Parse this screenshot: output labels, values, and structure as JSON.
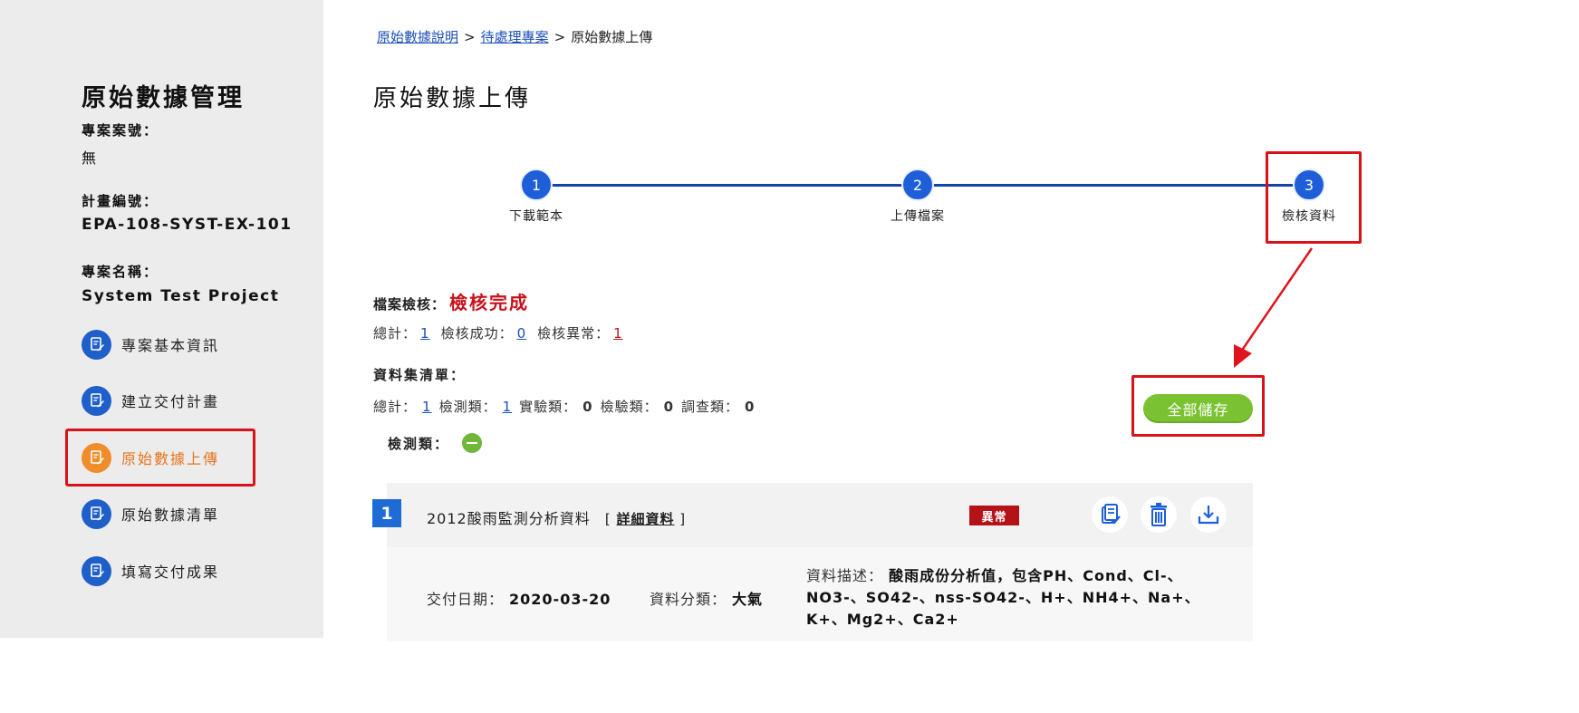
{
  "sidebar": {
    "title": "原始數據管理",
    "case_no_label": "專案案號：",
    "case_no_value": "無",
    "plan_no_label": "計畫編號：",
    "plan_no_value": "EPA-108-SYST-EX-101",
    "project_name_label": "專案名稱：",
    "project_name_value": "System Test Project",
    "menu": [
      {
        "label": "專案基本資訊",
        "icon": "edit-document-icon"
      },
      {
        "label": "建立交付計畫",
        "icon": "edit-document-icon"
      },
      {
        "label": "原始數據上傳",
        "icon": "edit-document-icon",
        "active": true
      },
      {
        "label": "原始數據清單",
        "icon": "edit-document-icon"
      },
      {
        "label": "填寫交付成果",
        "icon": "edit-document-icon"
      }
    ]
  },
  "breadcrumb": {
    "item1": "原始數據說明",
    "item2": "待處理專案",
    "current": "原始數據上傳",
    "separator": ">"
  },
  "page_title": "原始數據上傳",
  "steps": [
    {
      "num": "1",
      "label": "下載範本"
    },
    {
      "num": "2",
      "label": "上傳檔案"
    },
    {
      "num": "3",
      "label": "檢核資料"
    }
  ],
  "check": {
    "label": "檔案檢核：",
    "status": "檢核完成",
    "total_label": "總計：",
    "total_value": "1",
    "success_label": "檢核成功：",
    "success_value": "0",
    "error_label": "檢核異常：",
    "error_value": "1"
  },
  "dataset": {
    "label": "資料集清單：",
    "total_label": "總計：",
    "total_value": "1",
    "monitor_label": "檢測類：",
    "monitor_value": "1",
    "experiment_label": "實驗類：",
    "experiment_value": "0",
    "inspect_label": "檢驗類：",
    "inspect_value": "0",
    "survey_label": "調查類：",
    "survey_value": "0",
    "category_label": "檢測類："
  },
  "save_all_label": "全部儲存",
  "item": {
    "index": "1",
    "title": "2012酸雨監測分析資料",
    "detail_open": "[",
    "detail_link": "詳細資料",
    "detail_close": "]",
    "status_badge": "異常",
    "date_label": "交付日期：",
    "date_value": "2020-03-20",
    "category_label": "資料分類：",
    "category_value": "大氣",
    "desc_label": "資料描述：",
    "desc_value": "酸雨成份分析值，包含PH、Cond、Cl-、NO3-、SO42-、nss-SO42-、H+、NH4+、Na+、K+、Mg2+、Ca2+"
  },
  "colors": {
    "primary_blue": "#1e5fd8",
    "active_orange": "#f08c2a",
    "error_red": "#c8111a",
    "save_green": "#7ac232",
    "highlight_red": "#d9121a"
  }
}
